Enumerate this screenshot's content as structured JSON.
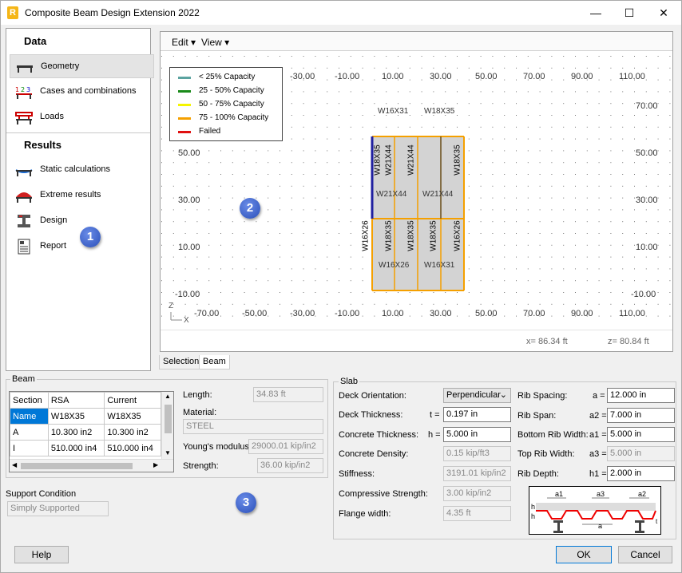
{
  "window": {
    "title": "Composite Beam Design Extension 2022",
    "app_letter": "R"
  },
  "nav": {
    "data_heading": "Data",
    "results_heading": "Results",
    "items": [
      {
        "label": "Geometry"
      },
      {
        "label": "Cases and combinations"
      },
      {
        "label": "Loads"
      },
      {
        "label": "Static calculations"
      },
      {
        "label": "Extreme results"
      },
      {
        "label": "Design"
      },
      {
        "label": "Report"
      }
    ]
  },
  "badges": [
    "1",
    "2",
    "3"
  ],
  "toolbar": {
    "edit": "Edit",
    "view": "View"
  },
  "legend": [
    {
      "label": "< 25% Capacity",
      "color": "#5ba3a0"
    },
    {
      "label": "25 - 50% Capacity",
      "color": "#1a8a1a"
    },
    {
      "label": "50 - 75% Capacity",
      "color": "#f5f500"
    },
    {
      "label": "75 - 100% Capacity",
      "color": "#f5a000"
    },
    {
      "label": "Failed",
      "color": "#e01010"
    }
  ],
  "axes": {
    "top_x": [
      "-30.00",
      "-10.00",
      "10.00",
      "30.00",
      "50.00",
      "70.00",
      "90.00",
      "110.00"
    ],
    "bottom_x": [
      "-70.00",
      "-50.00",
      "-30.00",
      "-10.00",
      "10.00",
      "30.00",
      "50.00",
      "70.00",
      "90.00",
      "110.00"
    ],
    "left_y": [
      "50.00",
      "30.00",
      "10.00",
      "-10.00"
    ],
    "right_y": [
      "70.00",
      "50.00",
      "30.00",
      "10.00",
      "-10.00"
    ],
    "axis_z": "Z",
    "axis_x": "X"
  },
  "beams": {
    "top": [
      "W16X31",
      "W18X35"
    ],
    "mid": [
      "W21X44",
      "W21X44"
    ],
    "bottom": [
      "W16X26",
      "W16X31"
    ],
    "upper_vertical": [
      "W18X35",
      "W21X44",
      "W21X44",
      "W18X35"
    ],
    "lower_vertical": [
      "W16X26",
      "W18X35",
      "W18X35",
      "W18X35",
      "W16X26"
    ]
  },
  "coords": {
    "x": "x= 86.34 ft",
    "z": "z= 80.84 ft"
  },
  "tabs": [
    "Selection",
    "Beam"
  ],
  "beam_group": {
    "title": "Beam",
    "headers": [
      "Section",
      "RSA",
      "Current"
    ],
    "rows": [
      {
        "key": "Name",
        "rsa": "W18X35",
        "current": "W18X35"
      },
      {
        "key": "A",
        "rsa": "10.300 in2",
        "current": "10.300 in2"
      },
      {
        "key": "I",
        "rsa": "510.000 in4",
        "current": "510.000 in4"
      }
    ],
    "length_label": "Length:",
    "length": "34.83 ft",
    "material_label": "Material:",
    "material": "STEEL",
    "young_label": "Young's modulus:",
    "young": "29000.01 kip/in2",
    "strength_label": "Strength:",
    "strength": "36.00 kip/in2"
  },
  "support": {
    "label": "Support Condition",
    "value": "Simply Supported"
  },
  "slab": {
    "title": "Slab",
    "deck_orientation_label": "Deck Orientation:",
    "deck_orientation": "Perpendicular",
    "deck_thickness_label": "Deck Thickness:",
    "deck_thickness_sym": "t =",
    "deck_thickness": "0.197 in",
    "concrete_thickness_label": "Concrete Thickness:",
    "concrete_thickness_sym": "h =",
    "concrete_thickness": "5.000 in",
    "concrete_density_label": "Concrete Density:",
    "concrete_density": "0.15 kip/ft3",
    "stiffness_label": "Stiffness:",
    "stiffness": "3191.01 kip/in2",
    "compressive_label": "Compressive Strength:",
    "compressive": "3.00 kip/in2",
    "flange_label": "Flange width:",
    "flange": "4.35 ft",
    "rib_spacing_label": "Rib Spacing:",
    "rib_spacing_sym": "a =",
    "rib_spacing": "12.000 in",
    "rib_span_label": "Rib Span:",
    "rib_span_sym": "a2 =",
    "rib_span": "7.000 in",
    "bottom_rib_label": "Bottom Rib Width:",
    "bottom_rib_sym": "a1 =",
    "bottom_rib": "5.000 in",
    "top_rib_label": "Top Rib Width:",
    "top_rib_sym": "a3 =",
    "top_rib": "5.000 in",
    "rib_depth_label": "Rib Depth:",
    "rib_depth_sym": "h1 =",
    "rib_depth": "2.000 in"
  },
  "buttons": {
    "help": "Help",
    "ok": "OK",
    "cancel": "Cancel"
  }
}
